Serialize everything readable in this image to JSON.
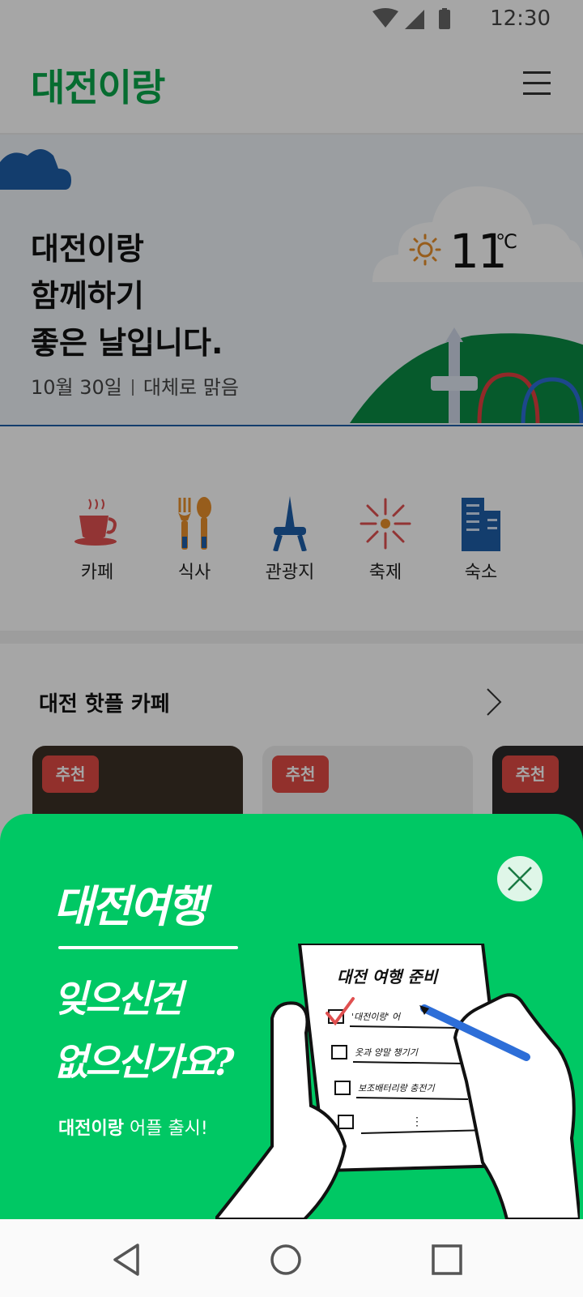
{
  "status_bar": {
    "time": "12:30",
    "icons": [
      "wifi-icon",
      "cellular-signal-icon",
      "battery-icon"
    ]
  },
  "header": {
    "logo": "대전이랑",
    "menu_icon": "hamburger-menu-icon"
  },
  "hero": {
    "title_lines": [
      "대전이랑",
      "함께하기",
      "좋은 날입니다."
    ],
    "date": "10월 30일",
    "weather_text": "대체로 맑음",
    "temperature": "11",
    "unit": "℃",
    "weather_icon": "sun-icon"
  },
  "categories": [
    {
      "label": "카페",
      "icon": "coffee-cup-icon"
    },
    {
      "label": "식사",
      "icon": "fork-spoon-icon"
    },
    {
      "label": "관광지",
      "icon": "tower-icon"
    },
    {
      "label": "축제",
      "icon": "firework-icon"
    },
    {
      "label": "숙소",
      "icon": "building-icon"
    }
  ],
  "section": {
    "title": "대전 핫플 카페",
    "cards": [
      {
        "badge": "추천"
      },
      {
        "badge": "추천"
      },
      {
        "badge": "추천"
      }
    ]
  },
  "popup": {
    "headline": "대전여행",
    "subline_1": "잊으신건",
    "subline_2": "없으신가요?",
    "app_name": "대전이랑",
    "launch_text": "어플 출시!",
    "checklist_title": "대전 여행 준비",
    "checklist_items": [
      "'대전이랑' 어",
      "옷과 양말 챙기기",
      "보조배터리랑 충전기",
      "⋮"
    ]
  },
  "colors": {
    "brand_green": "#0aa74a",
    "popup_green": "#00c864",
    "badge_red": "#e14a44",
    "hero_band_blue": "#1e5ea8"
  },
  "navbar": {
    "icons": [
      "back-triangle-icon",
      "home-circle-icon",
      "recents-square-icon"
    ]
  }
}
